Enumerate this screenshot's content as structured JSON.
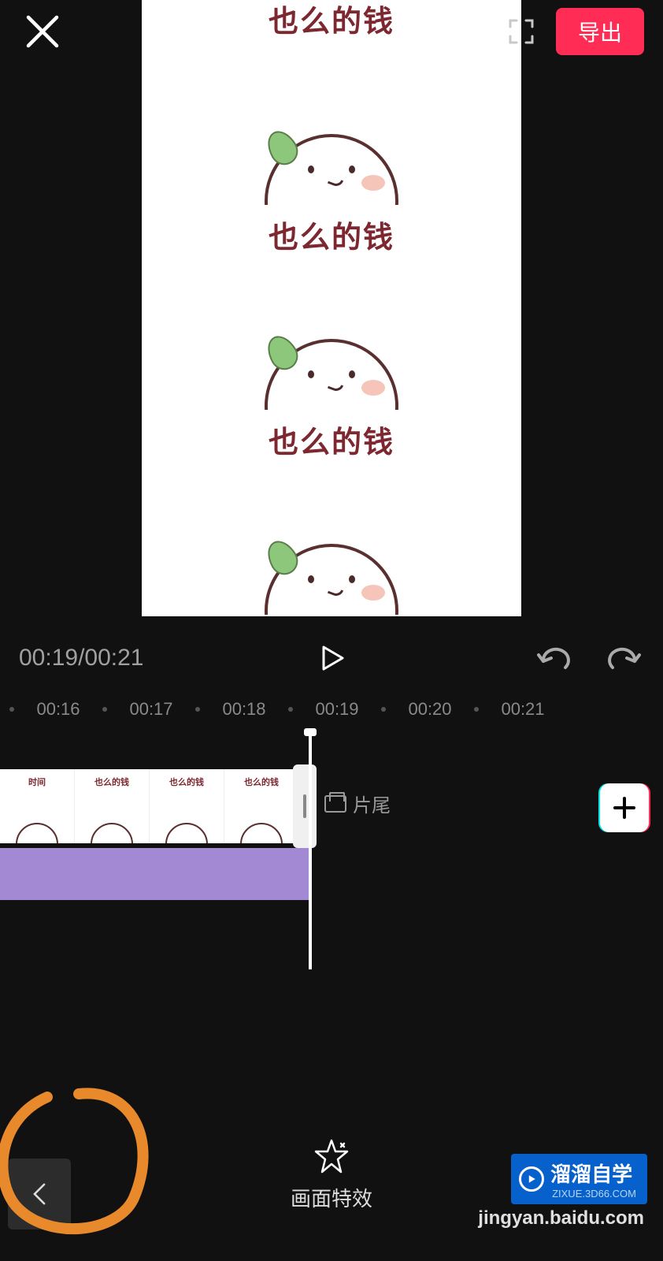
{
  "header": {
    "export_label": "导出"
  },
  "preview": {
    "panel_text": "也么的钱"
  },
  "controls": {
    "current_time": "00:19",
    "total_time": "00:21"
  },
  "ruler": {
    "ticks": [
      "00:16",
      "00:17",
      "00:18",
      "00:19",
      "00:20",
      "00:21"
    ]
  },
  "timeline": {
    "thumb_text_0": "时间",
    "thumb_text": "也么的钱",
    "end_label": "片尾"
  },
  "bottom": {
    "effect_label": "画面特效"
  },
  "watermark": {
    "logo_text": "溜溜自学",
    "logo_sub": "ZIXUE.3D66.COM",
    "source": "jingyan.baidu.com"
  }
}
